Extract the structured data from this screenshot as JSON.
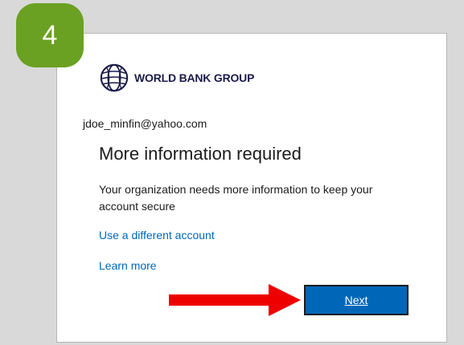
{
  "step_badge": {
    "number": "4",
    "color": "#6aa122"
  },
  "dialog": {
    "logo": {
      "icon": "globe-icon",
      "text": "WORLD BANK GROUP"
    },
    "account_email": "jdoe_minfin@yahoo.com",
    "title": "More information required",
    "description": "Your organization needs more information to keep your account secure",
    "links": {
      "use_different_account": "Use a different account",
      "learn_more": "Learn more"
    },
    "next_button": {
      "label": "Next",
      "color": "#0067b8"
    }
  },
  "annotation": {
    "arrow_icon": "arrow-right-icon",
    "arrow_color": "#ee0000"
  }
}
